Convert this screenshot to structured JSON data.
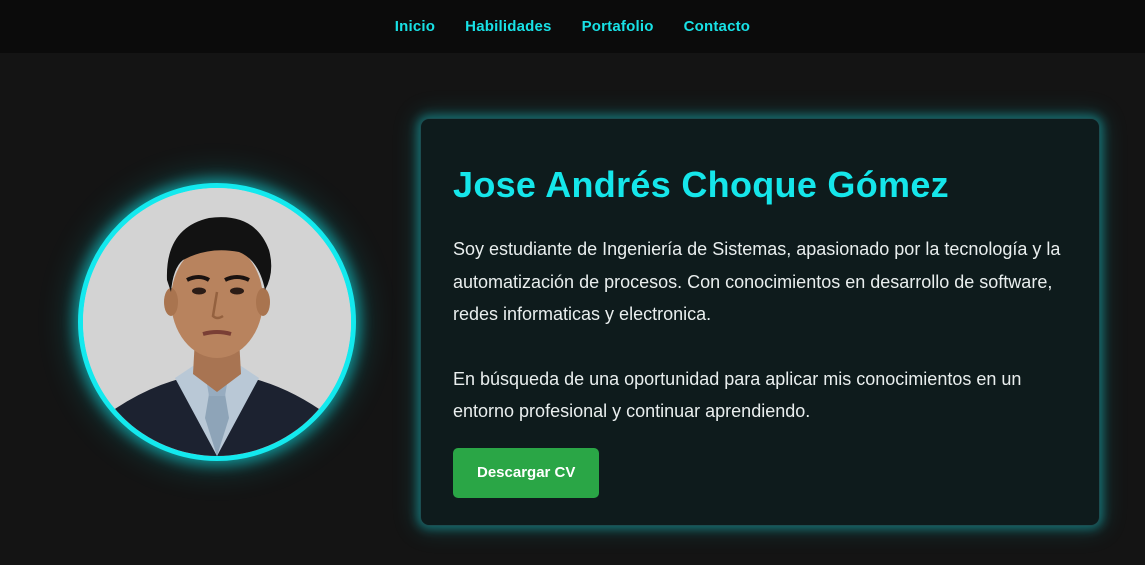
{
  "nav": {
    "items": [
      {
        "label": "Inicio"
      },
      {
        "label": "Habilidades"
      },
      {
        "label": "Portafolio"
      },
      {
        "label": "Contacto"
      }
    ]
  },
  "profile": {
    "photo_icon": "profile-photo",
    "name": "Jose Andrés Choque Gómez",
    "paragraph1": "Soy estudiante de Ingeniería de Sistemas, apasionado por la tecnología y la automatización de procesos. Con conocimientos en desarrollo de software, redes informaticas y electronica.",
    "paragraph2": "En búsqueda de una oportunidad para aplicar mis conocimientos en un entorno profesional y continuar aprendiendo.",
    "cv_button": "Descargar CV"
  },
  "colors": {
    "accent": "#15e6ea",
    "button": "#2aa646",
    "background": "#141414",
    "card": "#0e1b1c"
  }
}
